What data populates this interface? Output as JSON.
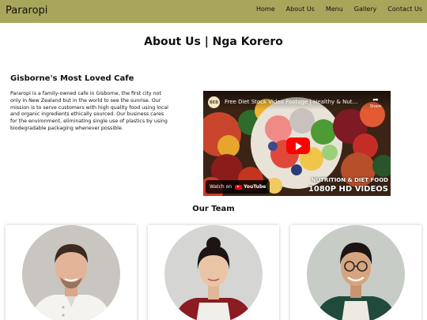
{
  "header": {
    "brand": "Pararopi",
    "nav": [
      "Home",
      "About Us",
      "Menu",
      "Gallery",
      "Contact Us"
    ]
  },
  "page_title": "About Us | Nga Korero",
  "about": {
    "heading": "Gisborne's Most Loved Cafe",
    "text": "Pararopi is a family-owned cafe in Gisborne, the first city not only in New Zealand but in the world to see the sunrise. Our mission is to serve customers with high quality food using local and organic ingredients ethically sourced. Our business cares for the environment, eliminating single use of plastics by using biodegradable packaging whenever possible."
  },
  "video": {
    "channel_icon_text": "BEB",
    "title": "Free Diet Stock Video Footage | Healthy & Nutrition...",
    "share_label": "Share",
    "watch_on": "Watch on",
    "youtube": "YouTube",
    "overlay_line1": "NUTRITION & DIET FOOD",
    "overlay_line2": "1080P HD VIDEOS"
  },
  "team": {
    "heading": "Our Team",
    "members": [
      {
        "icon": "chef-man-photo"
      },
      {
        "icon": "woman-apron-photo"
      },
      {
        "icon": "man-glasses-apron-photo"
      }
    ]
  },
  "colors": {
    "navbar": "#a8a65a",
    "play": "#ff0000"
  }
}
